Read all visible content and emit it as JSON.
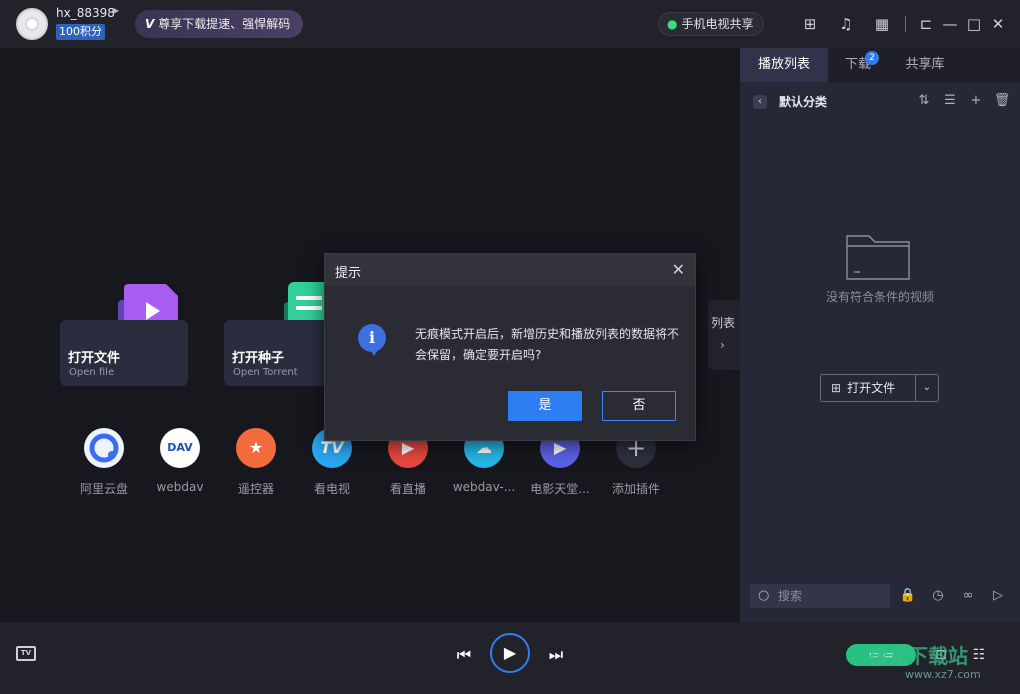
{
  "user": {
    "name": "hx_88398",
    "points": "100积分"
  },
  "promo": {
    "v_logo": "V",
    "text": "尊享下载提速、强悍解码"
  },
  "share": {
    "label": "手机电视共享"
  },
  "main": {
    "cards": [
      {
        "title": "打开文件",
        "sub": "Open file"
      },
      {
        "title": "打开种子",
        "sub": "Open Torrent"
      }
    ],
    "plugins": [
      {
        "label": "阿里云盘",
        "color": "#3a6cf0"
      },
      {
        "label": "webdav",
        "color": "#ffffff",
        "glyph": "DAV"
      },
      {
        "label": "遥控器",
        "color": "#f26b3a",
        "glyph": "★"
      },
      {
        "label": "看电视",
        "color": "#2ba7f1",
        "glyph": "TV"
      },
      {
        "label": "看直播",
        "color": "#e8493f",
        "glyph": "▶"
      },
      {
        "label": "webdav-...",
        "color": "#29b6e8",
        "glyph": "☁"
      },
      {
        "label": "电影天堂...",
        "color": "#5b61e6",
        "glyph": "▶"
      },
      {
        "label": "添加插件",
        "color": "#2d2f3d",
        "glyph": "+"
      }
    ],
    "list_tab": "列表"
  },
  "sidebar": {
    "tabs": [
      {
        "label": "播放列表",
        "active": true
      },
      {
        "label": "下载",
        "badge": "2"
      },
      {
        "label": "共享库"
      }
    ],
    "category": "默认分类",
    "empty_text": "没有符合条件的视频",
    "open_button": "打开文件",
    "search_placeholder": "搜索"
  },
  "dialog": {
    "title": "提示",
    "message": "无痕模式开启后，新增历史和播放列表的数据将不会保留，确定要开启吗?",
    "yes": "是",
    "no": "否"
  },
  "watermark": {
    "main": "极光下载站",
    "sub": "www.xz7.com"
  },
  "colors": {
    "accent": "#2e7ef3",
    "sidebar_bg": "#262837",
    "titlebar_bg": "#22222b"
  }
}
